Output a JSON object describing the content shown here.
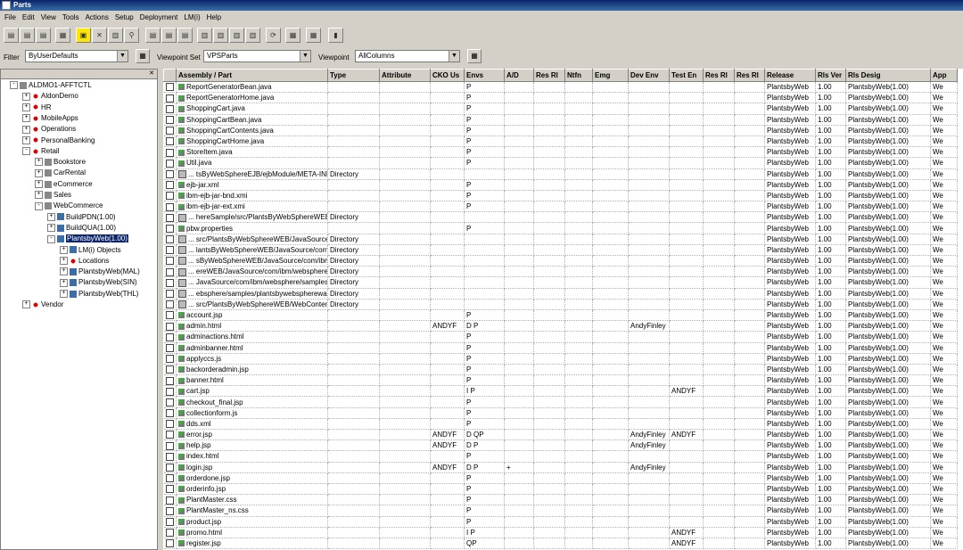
{
  "window": {
    "title": "Parts"
  },
  "menu": [
    "File",
    "Edit",
    "View",
    "Tools",
    "Actions",
    "Setup",
    "Deployment",
    "LM(i)",
    "Help"
  ],
  "filters": {
    "filter_label": "Filter",
    "filter_value": "ByUserDefaults",
    "vpset_label": "Viewpoint Set",
    "vpset_value": "VPSParts",
    "vp_label": "Viewpoint",
    "vp_value": "AllColumns"
  },
  "tree": {
    "nodes": [
      {
        "label": "ALDMO1-AFFTCTL",
        "level": 0,
        "exp": "-",
        "icon": "grey"
      },
      {
        "label": "AldonDemo",
        "level": 1,
        "exp": "+",
        "icon": "red"
      },
      {
        "label": "HR",
        "level": 1,
        "exp": "+",
        "icon": "red"
      },
      {
        "label": "MobileApps",
        "level": 1,
        "exp": "+",
        "icon": "red"
      },
      {
        "label": "Operations",
        "level": 1,
        "exp": "+",
        "icon": "red"
      },
      {
        "label": "PersonalBanking",
        "level": 1,
        "exp": "+",
        "icon": "red"
      },
      {
        "label": "Retail",
        "level": 1,
        "exp": "-",
        "icon": "red"
      },
      {
        "label": "Bookstore",
        "level": 2,
        "exp": "+",
        "icon": "grey"
      },
      {
        "label": "CarRental",
        "level": 2,
        "exp": "+",
        "icon": "grey"
      },
      {
        "label": "eCommerce",
        "level": 2,
        "exp": "+",
        "icon": "grey"
      },
      {
        "label": "Sales",
        "level": 2,
        "exp": "+",
        "icon": "grey"
      },
      {
        "label": "WebCommerce",
        "level": 2,
        "exp": "-",
        "icon": "grey"
      },
      {
        "label": "BuildPDN(1.00)",
        "level": 3,
        "exp": "+",
        "icon": "blue"
      },
      {
        "label": "BuildQUA(1.00)",
        "level": 3,
        "exp": "+",
        "icon": "blue"
      },
      {
        "label": "PlantsbyWeb(1.00)",
        "level": 3,
        "exp": "-",
        "icon": "blue",
        "selected": true
      },
      {
        "label": "LM(i) Objects",
        "level": 4,
        "exp": "+",
        "icon": "blue"
      },
      {
        "label": "Locations",
        "level": 4,
        "exp": "+",
        "icon": "red"
      },
      {
        "label": "PlantsbyWeb(MAL)",
        "level": 4,
        "exp": "+",
        "icon": "blue"
      },
      {
        "label": "PlantsbyWeb(SIN)",
        "level": 4,
        "exp": "+",
        "icon": "blue"
      },
      {
        "label": "PlantsbyWeb(THL)",
        "level": 4,
        "exp": "+",
        "icon": "blue"
      },
      {
        "label": "Vendor",
        "level": 1,
        "exp": "+",
        "icon": "red"
      }
    ]
  },
  "grid": {
    "columns": [
      "",
      "Assembly / Part",
      "Type",
      "Attribute",
      "CKO Us",
      "Envs",
      "A/D",
      "Res Rl",
      "Ntfn",
      "Emg",
      "Dev Env",
      "Test En",
      "Res Rl",
      "Res Rl",
      "Release",
      "Rls Ver",
      "Rls Desig",
      "App"
    ],
    "rows": [
      [
        "",
        "ReportGeneratorBean.java",
        "",
        "",
        "",
        "P",
        "",
        "",
        "",
        "",
        "",
        "",
        "",
        "",
        "PlantsbyWeb",
        "1.00",
        "PlantsbyWeb(1.00)",
        "We"
      ],
      [
        "",
        "ReportGeneratorHome.java",
        "",
        "",
        "",
        "P",
        "",
        "",
        "",
        "",
        "",
        "",
        "",
        "",
        "PlantsbyWeb",
        "1.00",
        "PlantsbyWeb(1.00)",
        "We"
      ],
      [
        "",
        "ShoppingCart.java",
        "",
        "",
        "",
        "P",
        "",
        "",
        "",
        "",
        "",
        "",
        "",
        "",
        "PlantsbyWeb",
        "1.00",
        "PlantsbyWeb(1.00)",
        "We"
      ],
      [
        "",
        "ShoppingCartBean.java",
        "",
        "",
        "",
        "P",
        "",
        "",
        "",
        "",
        "",
        "",
        "",
        "",
        "PlantsbyWeb",
        "1.00",
        "PlantsbyWeb(1.00)",
        "We"
      ],
      [
        "",
        "ShoppingCartContents.java",
        "",
        "",
        "",
        "P",
        "",
        "",
        "",
        "",
        "",
        "",
        "",
        "",
        "PlantsbyWeb",
        "1.00",
        "PlantsbyWeb(1.00)",
        "We"
      ],
      [
        "",
        "ShoppingCartHome.java",
        "",
        "",
        "",
        "P",
        "",
        "",
        "",
        "",
        "",
        "",
        "",
        "",
        "PlantsbyWeb",
        "1.00",
        "PlantsbyWeb(1.00)",
        "We"
      ],
      [
        "",
        "StoreItem.java",
        "",
        "",
        "",
        "P",
        "",
        "",
        "",
        "",
        "",
        "",
        "",
        "",
        "PlantsbyWeb",
        "1.00",
        "PlantsbyWeb(1.00)",
        "We"
      ],
      [
        "",
        "Util.java",
        "",
        "",
        "",
        "P",
        "",
        "",
        "",
        "",
        "",
        "",
        "",
        "",
        "PlantsbyWeb",
        "1.00",
        "PlantsbyWeb(1.00)",
        "We"
      ],
      [
        "D",
        "... tsByWebSphereEJB/ejbModule/META-INF",
        "Directory",
        "",
        "",
        "",
        "",
        "",
        "",
        "",
        "",
        "",
        "",
        "",
        "PlantsbyWeb",
        "1.00",
        "PlantsbyWeb(1.00)",
        "We"
      ],
      [
        "",
        "ejb-jar.xml",
        "",
        "",
        "",
        "P",
        "",
        "",
        "",
        "",
        "",
        "",
        "",
        "",
        "PlantsbyWeb",
        "1.00",
        "PlantsbyWeb(1.00)",
        "We"
      ],
      [
        "",
        "ibm-ejb-jar-bnd.xmi",
        "",
        "",
        "",
        "P",
        "",
        "",
        "",
        "",
        "",
        "",
        "",
        "",
        "PlantsbyWeb",
        "1.00",
        "PlantsbyWeb(1.00)",
        "We"
      ],
      [
        "",
        "ibm-ejb-jar-ext.xmi",
        "",
        "",
        "",
        "P",
        "",
        "",
        "",
        "",
        "",
        "",
        "",
        "",
        "PlantsbyWeb",
        "1.00",
        "PlantsbyWeb(1.00)",
        "We"
      ],
      [
        "D",
        "... hereSample/src/PlantsByWebSphereWEB",
        "Directory",
        "",
        "",
        "",
        "",
        "",
        "",
        "",
        "",
        "",
        "",
        "",
        "PlantsbyWeb",
        "1.00",
        "PlantsbyWeb(1.00)",
        "We"
      ],
      [
        "",
        "pbw.properties",
        "",
        "",
        "",
        "P",
        "",
        "",
        "",
        "",
        "",
        "",
        "",
        "",
        "PlantsbyWeb",
        "1.00",
        "PlantsbyWeb(1.00)",
        "We"
      ],
      [
        "D",
        "... src/PlantsByWebSphereWEB/JavaSource",
        "Directory",
        "",
        "",
        "",
        "",
        "",
        "",
        "",
        "",
        "",
        "",
        "",
        "PlantsbyWeb",
        "1.00",
        "PlantsbyWeb(1.00)",
        "We"
      ],
      [
        "D",
        "... lantsByWebSphereWEB/JavaSource/com",
        "Directory",
        "",
        "",
        "",
        "",
        "",
        "",
        "",
        "",
        "",
        "",
        "",
        "PlantsbyWeb",
        "1.00",
        "PlantsbyWeb(1.00)",
        "We"
      ],
      [
        "D",
        "... sByWebSphereWEB/JavaSource/com/ibm",
        "Directory",
        "",
        "",
        "",
        "",
        "",
        "",
        "",
        "",
        "",
        "",
        "",
        "PlantsbyWeb",
        "1.00",
        "PlantsbyWeb(1.00)",
        "We"
      ],
      [
        "D",
        "... ereWEB/JavaSource/com/ibm/websphere",
        "Directory",
        "",
        "",
        "",
        "",
        "",
        "",
        "",
        "",
        "",
        "",
        "",
        "PlantsbyWeb",
        "1.00",
        "PlantsbyWeb(1.00)",
        "We"
      ],
      [
        "D",
        "... JavaSource/com/ibm/websphere/samples",
        "Directory",
        "",
        "",
        "",
        "",
        "",
        "",
        "",
        "",
        "",
        "",
        "",
        "PlantsbyWeb",
        "1.00",
        "PlantsbyWeb(1.00)",
        "We"
      ],
      [
        "D",
        "... ebsphere/samples/plantsbywebspherewar",
        "Directory",
        "",
        "",
        "",
        "",
        "",
        "",
        "",
        "",
        "",
        "",
        "",
        "PlantsbyWeb",
        "1.00",
        "PlantsbyWeb(1.00)",
        "We"
      ],
      [
        "D",
        "... src/PlantsByWebSphereWEB/WebContent",
        "Directory",
        "",
        "",
        "",
        "",
        "",
        "",
        "",
        "",
        "",
        "",
        "",
        "PlantsbyWeb",
        "1.00",
        "PlantsbyWeb(1.00)",
        "We"
      ],
      [
        "",
        "account.jsp",
        "",
        "",
        "",
        "P",
        "",
        "",
        "",
        "",
        "",
        "",
        "",
        "",
        "PlantsbyWeb",
        "1.00",
        "PlantsbyWeb(1.00)",
        "We"
      ],
      [
        "",
        "admin.html",
        "",
        "",
        "ANDYF",
        "D  P",
        "",
        "",
        "",
        "",
        "AndyFinley",
        "",
        "",
        "",
        "PlantsbyWeb",
        "1.00",
        "PlantsbyWeb(1.00)",
        "We"
      ],
      [
        "",
        "adminactions.html",
        "",
        "",
        "",
        "P",
        "",
        "",
        "",
        "",
        "",
        "",
        "",
        "",
        "PlantsbyWeb",
        "1.00",
        "PlantsbyWeb(1.00)",
        "We"
      ],
      [
        "",
        "adminbanner.html",
        "",
        "",
        "",
        "P",
        "",
        "",
        "",
        "",
        "",
        "",
        "",
        "",
        "PlantsbyWeb",
        "1.00",
        "PlantsbyWeb(1.00)",
        "We"
      ],
      [
        "",
        "applyccs.js",
        "",
        "",
        "",
        "P",
        "",
        "",
        "",
        "",
        "",
        "",
        "",
        "",
        "PlantsbyWeb",
        "1.00",
        "PlantsbyWeb(1.00)",
        "We"
      ],
      [
        "",
        "backorderadmin.jsp",
        "",
        "",
        "",
        "P",
        "",
        "",
        "",
        "",
        "",
        "",
        "",
        "",
        "PlantsbyWeb",
        "1.00",
        "PlantsbyWeb(1.00)",
        "We"
      ],
      [
        "",
        "banner.html",
        "",
        "",
        "",
        "P",
        "",
        "",
        "",
        "",
        "",
        "",
        "",
        "",
        "PlantsbyWeb",
        "1.00",
        "PlantsbyWeb(1.00)",
        "We"
      ],
      [
        "",
        "cart.jsp",
        "",
        "",
        "",
        "I  P",
        "",
        "",
        "",
        "",
        "",
        "ANDYF",
        "",
        "",
        "PlantsbyWeb",
        "1.00",
        "PlantsbyWeb(1.00)",
        "We"
      ],
      [
        "",
        "checkout_final.jsp",
        "",
        "",
        "",
        "P",
        "",
        "",
        "",
        "",
        "",
        "",
        "",
        "",
        "PlantsbyWeb",
        "1.00",
        "PlantsbyWeb(1.00)",
        "We"
      ],
      [
        "",
        "collectionform.js",
        "",
        "",
        "",
        "P",
        "",
        "",
        "",
        "",
        "",
        "",
        "",
        "",
        "PlantsbyWeb",
        "1.00",
        "PlantsbyWeb(1.00)",
        "We"
      ],
      [
        "",
        "dds.xml",
        "",
        "",
        "",
        "P",
        "",
        "",
        "",
        "",
        "",
        "",
        "",
        "",
        "PlantsbyWeb",
        "1.00",
        "PlantsbyWeb(1.00)",
        "We"
      ],
      [
        "",
        "error.jsp",
        "",
        "",
        "ANDYF",
        "D QP",
        "",
        "",
        "",
        "",
        "AndyFinley",
        "ANDYF",
        "",
        "",
        "PlantsbyWeb",
        "1.00",
        "PlantsbyWeb(1.00)",
        "We"
      ],
      [
        "",
        "help.jsp",
        "",
        "",
        "ANDYF",
        "D  P",
        "",
        "",
        "",
        "",
        "AndyFinley",
        "",
        "",
        "",
        "PlantsbyWeb",
        "1.00",
        "PlantsbyWeb(1.00)",
        "We"
      ],
      [
        "",
        "index.html",
        "",
        "",
        "",
        "P",
        "",
        "",
        "",
        "",
        "",
        "",
        "",
        "",
        "PlantsbyWeb",
        "1.00",
        "PlantsbyWeb(1.00)",
        "We"
      ],
      [
        "",
        "login.jsp",
        "",
        "",
        "ANDYF",
        "D  P",
        "+",
        "",
        "",
        "",
        "AndyFinley",
        "",
        "",
        "",
        "PlantsbyWeb",
        "1.00",
        "PlantsbyWeb(1.00)",
        "We"
      ],
      [
        "",
        "orderdone.jsp",
        "",
        "",
        "",
        "P",
        "",
        "",
        "",
        "",
        "",
        "",
        "",
        "",
        "PlantsbyWeb",
        "1.00",
        "PlantsbyWeb(1.00)",
        "We"
      ],
      [
        "",
        "orderinfo.jsp",
        "",
        "",
        "",
        "P",
        "",
        "",
        "",
        "",
        "",
        "",
        "",
        "",
        "PlantsbyWeb",
        "1.00",
        "PlantsbyWeb(1.00)",
        "We"
      ],
      [
        "",
        "PlantMaster.css",
        "",
        "",
        "",
        "P",
        "",
        "",
        "",
        "",
        "",
        "",
        "",
        "",
        "PlantsbyWeb",
        "1.00",
        "PlantsbyWeb(1.00)",
        "We"
      ],
      [
        "",
        "PlantMaster_ns.css",
        "",
        "",
        "",
        "P",
        "",
        "",
        "",
        "",
        "",
        "",
        "",
        "",
        "PlantsbyWeb",
        "1.00",
        "PlantsbyWeb(1.00)",
        "We"
      ],
      [
        "",
        "product.jsp",
        "",
        "",
        "",
        "P",
        "",
        "",
        "",
        "",
        "",
        "",
        "",
        "",
        "PlantsbyWeb",
        "1.00",
        "PlantsbyWeb(1.00)",
        "We"
      ],
      [
        "",
        "promo.html",
        "",
        "",
        "",
        "I  P",
        "",
        "",
        "",
        "",
        "",
        "ANDYF",
        "",
        "",
        "PlantsbyWeb",
        "1.00",
        "PlantsbyWeb(1.00)",
        "We"
      ],
      [
        "",
        "register.jsp",
        "",
        "",
        "",
        "QP",
        "",
        "",
        "",
        "",
        "",
        "ANDYF",
        "",
        "",
        "PlantsbyWeb",
        "1.00",
        "PlantsbyWeb(1.00)",
        "We"
      ]
    ]
  }
}
